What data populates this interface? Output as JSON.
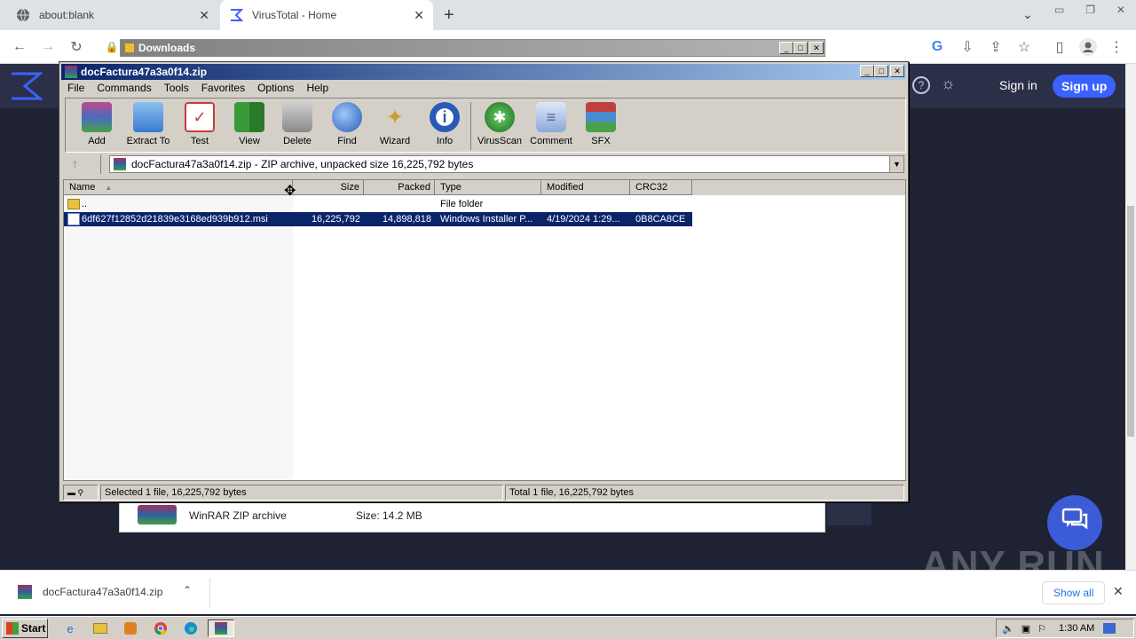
{
  "browser": {
    "tabs": [
      {
        "title": "about:blank"
      },
      {
        "title": "VirusTotal - Home"
      }
    ],
    "new_tab_symbol": "+"
  },
  "virustotal": {
    "signin_label": "Sign in",
    "signup_label": "Sign up"
  },
  "downloads_window": {
    "title": "Downloads"
  },
  "winrar": {
    "title": "docFactura47a3a0f14.zip",
    "menu": [
      "File",
      "Commands",
      "Tools",
      "Favorites",
      "Options",
      "Help"
    ],
    "tools": [
      {
        "label": "Add",
        "icon": "add-archive-icon",
        "color": "#b84a2a"
      },
      {
        "label": "Extract To",
        "icon": "extract-folder-icon",
        "color": "#4a8fd8"
      },
      {
        "label": "Test",
        "icon": "test-clipboard-icon",
        "color": "#c83a3a"
      },
      {
        "label": "View",
        "icon": "view-book-icon",
        "color": "#3a9a3a"
      },
      {
        "label": "Delete",
        "icon": "delete-trash-icon",
        "color": "#8a8a8a"
      },
      {
        "label": "Find",
        "icon": "find-magnifier-icon",
        "color": "#3a6ad0"
      },
      {
        "label": "Wizard",
        "icon": "wizard-wand-icon",
        "color": "#c8a030"
      },
      {
        "label": "Info",
        "icon": "info-icon",
        "color": "#2a5ab8"
      },
      {
        "label": "VirusScan",
        "icon": "virusscan-bug-icon",
        "color": "#2a8a2a"
      },
      {
        "label": "Comment",
        "icon": "comment-icon",
        "color": "#7a9ac8"
      },
      {
        "label": "SFX",
        "icon": "sfx-books-icon",
        "color": "#c04040"
      }
    ],
    "path": "docFactura47a3a0f14.zip - ZIP archive, unpacked size 16,225,792 bytes",
    "columns": [
      "Name",
      "Size",
      "Packed",
      "Type",
      "Modified",
      "CRC32"
    ],
    "rows": [
      {
        "name": "..",
        "size": "",
        "packed": "",
        "type": "File folder",
        "modified": "",
        "crc": ""
      },
      {
        "name": "6df627f12852d21839e3168ed939b912.msi",
        "size": "16,225,792",
        "packed": "14,898,818",
        "type": "Windows Installer P...",
        "modified": "4/19/2024 1:29...",
        "crc": "0B8CA8CE"
      }
    ],
    "status_left": "Selected 1 file, 16,225,792 bytes",
    "status_right": "Total 1 file, 16,225,792 bytes"
  },
  "page_card": {
    "type": "WinRAR ZIP archive",
    "size": "Size: 14.2 MB"
  },
  "watermark": "ANY RUN",
  "download_bar": {
    "filename": "docFactura47a3a0f14.zip",
    "show_all": "Show all"
  },
  "taskbar": {
    "start_label": "Start",
    "clock": "1:30 AM"
  }
}
